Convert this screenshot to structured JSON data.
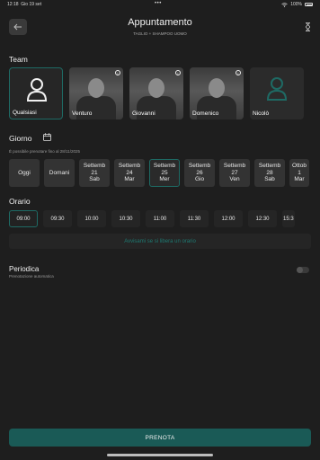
{
  "status_bar": {
    "time": "12:18",
    "date": "Gio 19 set",
    "battery": "100%"
  },
  "header": {
    "title": "Appuntamento",
    "subtitle": "TAGLIO + SHAMPOO UOMO"
  },
  "team": {
    "label": "Team",
    "members": [
      {
        "name": "Qualsiasi",
        "selected": true,
        "photo": false
      },
      {
        "name": "Venturo",
        "selected": false,
        "photo": true
      },
      {
        "name": "Giovanni",
        "selected": false,
        "photo": true
      },
      {
        "name": "Domenico",
        "selected": false,
        "photo": true
      },
      {
        "name": "Nicolò",
        "selected": false,
        "photo": false
      }
    ]
  },
  "date": {
    "label": "Giorno",
    "note": "È possibile prenotare fino al 28/11/2025",
    "chips": [
      {
        "lines": [
          "Oggi"
        ],
        "selected": false
      },
      {
        "lines": [
          "Domani"
        ],
        "selected": false
      },
      {
        "lines": [
          "Settemb",
          "21",
          "Sab"
        ],
        "selected": false
      },
      {
        "lines": [
          "Settemb",
          "24",
          "Mar"
        ],
        "selected": false
      },
      {
        "lines": [
          "Settemb",
          "25",
          "Mer"
        ],
        "selected": true
      },
      {
        "lines": [
          "Settemb",
          "26",
          "Gio"
        ],
        "selected": false
      },
      {
        "lines": [
          "Settemb",
          "27",
          "Ven"
        ],
        "selected": false
      },
      {
        "lines": [
          "Settemb",
          "28",
          "Sab"
        ],
        "selected": false
      },
      {
        "lines": [
          "Ottob",
          "1",
          "Mar"
        ],
        "selected": false
      }
    ]
  },
  "time": {
    "label": "Orario",
    "slots": [
      "09:00",
      "09:30",
      "10:00",
      "10:30",
      "11:00",
      "11:30",
      "12:00",
      "12:30",
      "15:3"
    ],
    "selected_index": 0,
    "notify_label": "Avvisami se si libera un orario"
  },
  "periodic": {
    "label": "Periodica",
    "sublabel": "Prenotazione automatica",
    "enabled": false
  },
  "book_button": {
    "label": "PRENOTA"
  },
  "colors": {
    "accent": "#1e6a64",
    "button": "#1a5a56",
    "background": "#1e1e1e"
  }
}
